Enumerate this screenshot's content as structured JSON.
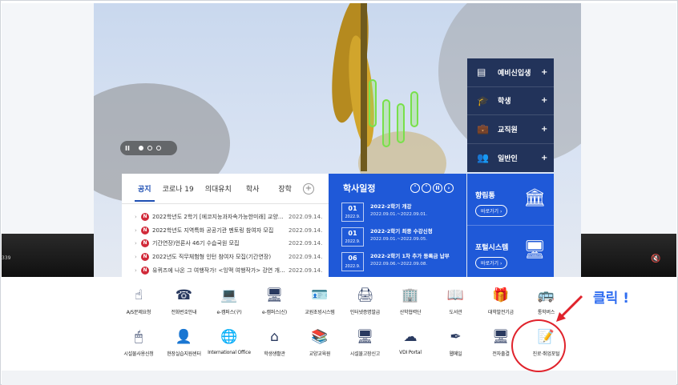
{
  "slider": {
    "pause_symbol": "II",
    "dots": 3,
    "active_dot": 0
  },
  "quick_menu": [
    {
      "label": "예비신입생",
      "icon": "document-icon",
      "plus": "+"
    },
    {
      "label": "학생",
      "icon": "graduation-cap-icon",
      "plus": "+"
    },
    {
      "label": "교직원",
      "icon": "briefcase-icon",
      "plus": "+"
    },
    {
      "label": "일반인",
      "icon": "people-icon",
      "plus": "+"
    }
  ],
  "notice": {
    "tabs": [
      "공지",
      "코로나 19",
      "의대유치",
      "학사",
      "장학"
    ],
    "active_tab": 0,
    "plus": "+",
    "items": [
      {
        "title": "2022학년도 2학기 [에코지능과자속가능한미래] 교양교…",
        "date": "2022.09.14."
      },
      {
        "title": "2022학년도 지역특화 공공기관 멘토링 참여자 모집",
        "date": "2022.09.14."
      },
      {
        "title": "기간연장)언론사 46기 수습국원 모집",
        "date": "2022.09.14."
      },
      {
        "title": "2022년도 직무체험형 인턴 참여자 모집(기간연장)",
        "date": "2022.09.14."
      },
      {
        "title": "유퀴즈에 나온 그 여행작가! <잉맥 여행작가> 강연 개최 :-)",
        "date": "2022.09.14."
      }
    ],
    "new_badge": "N",
    "bullet": "›"
  },
  "schedule": {
    "title": "학사일정",
    "nav": [
      "˄",
      "˅",
      "II",
      "›"
    ],
    "items": [
      {
        "day": "01",
        "month": "2022.9.",
        "title": "2022-2학기 개강",
        "period": "2022.09.01.~2022.09.01."
      },
      {
        "day": "01",
        "month": "2022.9.",
        "title": "2022-2학기 최종 수강신청",
        "period": "2022.09.01.~2022.09.05."
      },
      {
        "day": "06",
        "month": "2022.9.",
        "title": "2022-2학기 1차 추가 등록금 납부",
        "period": "2022.09.06.~2022.09.08."
      }
    ]
  },
  "portals": [
    {
      "title": "향림통",
      "button": "바로가기 ›",
      "icon": "bank-building-icon"
    },
    {
      "title": "포털시스템",
      "button": "바로가기 ›",
      "icon": "monitor-icon"
    }
  ],
  "video": {
    "timecode": "339",
    "mute_icon": "mute-icon"
  },
  "links_row1": [
    {
      "label": "A/S문제요청",
      "icon": "touch-hand-icon",
      "glyph": "☝"
    },
    {
      "label": "전화번호안내",
      "icon": "phone-icon",
      "glyph": "☎"
    },
    {
      "label": "e-캠퍼스(구)",
      "icon": "laptop-icon",
      "glyph": "💻"
    },
    {
      "label": "e-캠퍼스(신)",
      "icon": "chat-monitor-icon",
      "glyph": "🖥"
    },
    {
      "label": "교원초빙시스템",
      "icon": "id-card-icon",
      "glyph": "🪪"
    },
    {
      "label": "인터넷증명발급",
      "icon": "printer-icon",
      "glyph": "🖨"
    },
    {
      "label": "산학협력단",
      "icon": "building-icon",
      "glyph": "🏢"
    },
    {
      "label": "도서관",
      "icon": "book-icon",
      "glyph": "📖"
    },
    {
      "label": "대학발전기금",
      "icon": "gift-icon",
      "glyph": "🎁"
    },
    {
      "label": "통학버스",
      "icon": "bus-icon",
      "glyph": "🚌"
    }
  ],
  "links_row2": [
    {
      "label": "시설물사용신청",
      "icon": "mouse-icon",
      "glyph": "🖱"
    },
    {
      "label": "현장실습지원센터",
      "icon": "user-edit-icon",
      "glyph": "👤"
    },
    {
      "label": "International Office",
      "icon": "globe-icon",
      "glyph": "🌐"
    },
    {
      "label": "학생생활관",
      "icon": "house-icon",
      "glyph": "⌂"
    },
    {
      "label": "교양교육원",
      "icon": "books-icon",
      "glyph": "📚"
    },
    {
      "label": "시설물고장신고",
      "icon": "monitor-tools-icon",
      "glyph": "🖥"
    },
    {
      "label": "VDI Portal",
      "icon": "cloud-monitor-icon",
      "glyph": "☁"
    },
    {
      "label": "웹메일",
      "icon": "pen-icon",
      "glyph": "✒"
    },
    {
      "label": "전자출결",
      "icon": "desktop-icon",
      "glyph": "🖥"
    },
    {
      "label": "진로·취업포털",
      "icon": "document-pen-icon",
      "glyph": "📝"
    }
  ],
  "annotation": {
    "text": "클릭 !"
  }
}
